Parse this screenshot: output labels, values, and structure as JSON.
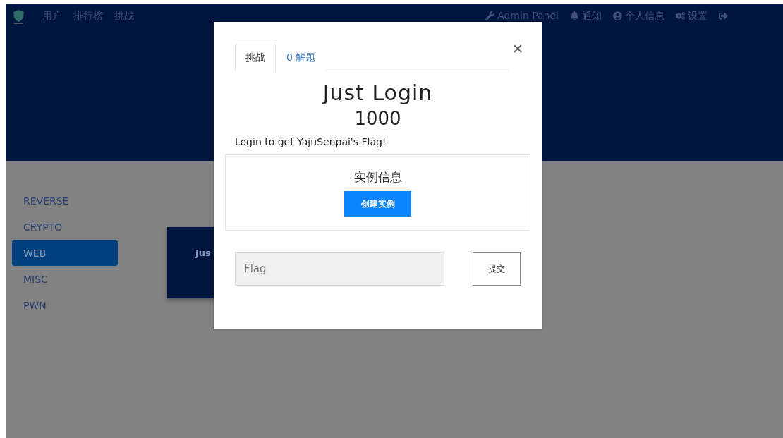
{
  "navbar": {
    "left_links": [
      "用户",
      "排行榜",
      "挑战"
    ],
    "right_links": [
      "Admin Panel",
      "通知",
      "个人信息",
      "设置"
    ]
  },
  "categories": [
    {
      "label": "REVERSE",
      "selected": false
    },
    {
      "label": "CRYPTO",
      "selected": false
    },
    {
      "label": "WEB",
      "selected": true
    },
    {
      "label": "MISC",
      "selected": false
    },
    {
      "label": "PWN",
      "selected": false
    }
  ],
  "challenge_card": {
    "title": "Jus"
  },
  "modal": {
    "tabs": [
      {
        "label": "挑战",
        "selected": true
      },
      {
        "label": "0 解题",
        "selected": false
      }
    ],
    "title": "Just Login",
    "value": "1000",
    "description": "Login to get YajuSenpai's Flag!",
    "instance": {
      "title": "实例信息",
      "button": "创建实例"
    },
    "flag": {
      "placeholder": "Flag"
    },
    "submit": "提交"
  }
}
